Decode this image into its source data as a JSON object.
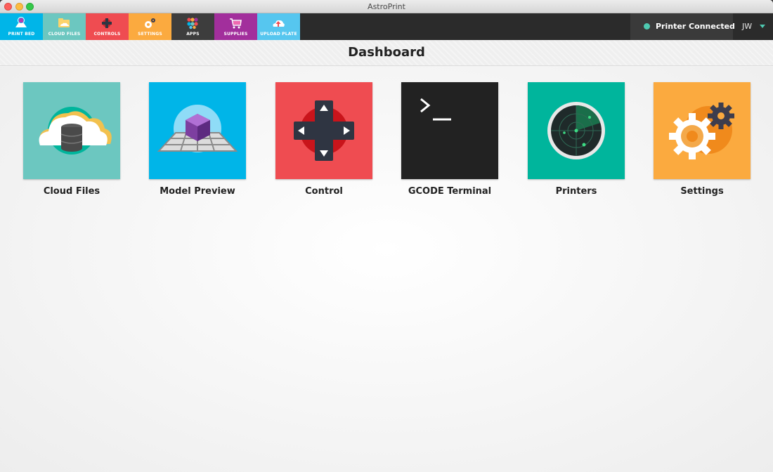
{
  "window": {
    "title": "AstroPrint"
  },
  "nav": {
    "tabs": [
      {
        "label": "PRINT BED",
        "icon": "printer-bed-icon",
        "color": "#00b5e8"
      },
      {
        "label": "CLOUD FILES",
        "icon": "cloud-folder-icon",
        "color": "#6cc7c0"
      },
      {
        "label": "CONTROLS",
        "icon": "dpad-icon",
        "color": "#ef4c51"
      },
      {
        "label": "SETTINGS",
        "icon": "gears-icon",
        "color": "#fbaa3f"
      },
      {
        "label": "APPS",
        "icon": "apps-grid-icon",
        "color": "#3d3d3d"
      },
      {
        "label": "SUPPLIES",
        "icon": "shopping-cart-icon",
        "color": "#a22f9c"
      },
      {
        "label": "UPLOAD PLATE",
        "icon": "cloud-upload-icon",
        "color": "#56c6ef"
      }
    ]
  },
  "status": {
    "text": "Printer Connected",
    "color": "#4ec9b0"
  },
  "user": {
    "initials": "JW"
  },
  "page": {
    "title": "Dashboard"
  },
  "tiles": [
    {
      "label": "Cloud Files",
      "icon": "cloud-database-icon",
      "color": "#6cc7c0"
    },
    {
      "label": "Model Preview",
      "icon": "cube-on-grid-icon",
      "color": "#00b5e8"
    },
    {
      "label": "Control",
      "icon": "dpad-icon",
      "color": "#ef4c51"
    },
    {
      "label": "GCODE Terminal",
      "icon": "terminal-prompt-icon",
      "color": "#222222"
    },
    {
      "label": "Printers",
      "icon": "radar-icon",
      "color": "#00b59c"
    },
    {
      "label": "Settings",
      "icon": "gears-icon",
      "color": "#fbaa3f"
    }
  ]
}
